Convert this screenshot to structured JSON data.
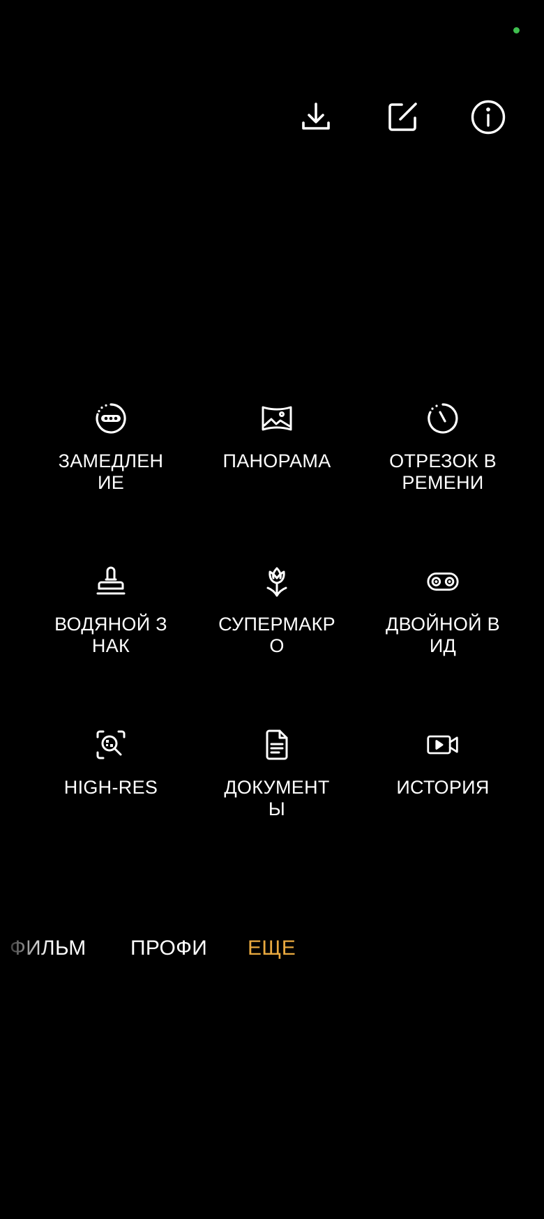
{
  "status_bar": {
    "indicator_color": "#3fbf4f"
  },
  "top_actions": [
    {
      "name": "download",
      "icon": "download-icon"
    },
    {
      "name": "edit",
      "icon": "edit-icon"
    },
    {
      "name": "info",
      "icon": "info-icon"
    }
  ],
  "modes": [
    {
      "label": "ЗАМЕДЛЕНИЕ",
      "icon": "slow-motion-icon"
    },
    {
      "label": "ПАНОРАМА",
      "icon": "panorama-icon"
    },
    {
      "label": "ОТРЕЗОК ВРЕМЕНИ",
      "icon": "time-lapse-icon"
    },
    {
      "label": "ВОДЯНОЙ ЗНАК",
      "icon": "watermark-stamp-icon"
    },
    {
      "label": "СУПЕРМАКРО",
      "icon": "super-macro-flower-icon"
    },
    {
      "label": "ДВОЙНОЙ ВИД",
      "icon": "dual-view-icon"
    },
    {
      "label": "HIGH-RES",
      "icon": "high-res-icon"
    },
    {
      "label": "ДОКУМЕНТЫ",
      "icon": "document-icon"
    },
    {
      "label": "ИСТОРИЯ",
      "icon": "story-video-icon"
    }
  ],
  "mode_strip": {
    "items": [
      "ФИЛЬМ",
      "ПРОФИ",
      "ЕЩЕ"
    ],
    "selected": "ЕЩЕ",
    "accent_color": "#e9a93f"
  }
}
